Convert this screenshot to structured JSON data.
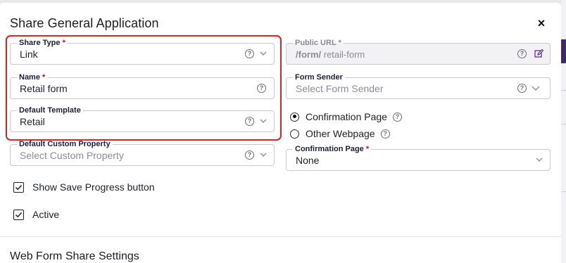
{
  "dialog": {
    "title": "Share General Application",
    "close_symbol": "×"
  },
  "left_fields": {
    "share_type": {
      "label": "Share Type",
      "required_mark": "*",
      "value": "Link",
      "help": "?"
    },
    "name": {
      "label": "Name",
      "required_mark": "*",
      "value": "Retail form",
      "help": "?"
    },
    "default_template": {
      "label": "Default Template",
      "value": "Retail",
      "help": "?"
    },
    "default_custom_property": {
      "label": "Default Custom Property",
      "placeholder": "Select Custom Property",
      "help": "?"
    }
  },
  "right_fields": {
    "public_url": {
      "label": "Public URL",
      "required_mark": "*",
      "prefix": "/form/",
      "value": "retail-form",
      "help": "?"
    },
    "form_sender": {
      "label": "Form Sender",
      "placeholder": "Select Form Sender",
      "help": "?"
    },
    "confirmation_options": [
      {
        "label": "Confirmation Page",
        "checked": true,
        "help": "?"
      },
      {
        "label": "Other Webpage",
        "checked": false,
        "help": "?"
      }
    ],
    "confirmation_page": {
      "label": "Confirmation Page",
      "required_mark": "*",
      "value": "None"
    }
  },
  "checkboxes": [
    {
      "label": "Show Save Progress button",
      "checked": true
    },
    {
      "label": "Active",
      "checked": true
    }
  ],
  "section": {
    "title": "Web Form Share Settings"
  },
  "colors": {
    "highlight_border": "#e02020",
    "required_asterisk": "#d0021b",
    "edit_icon": "#5b2ea6",
    "backdrop_accent": "#3f2a6e"
  }
}
